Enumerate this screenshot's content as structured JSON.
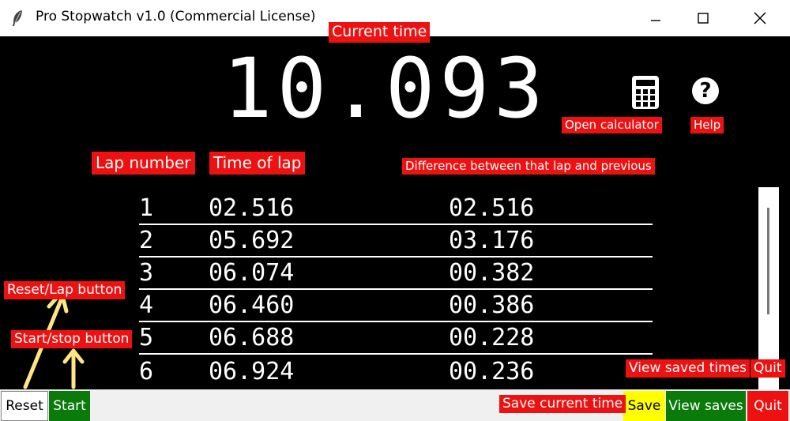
{
  "window": {
    "title": "Pro Stopwatch v1.0 (Commercial License)",
    "controls": [
      "minimize",
      "maximize",
      "close"
    ]
  },
  "stopwatch": {
    "current_time": "10.093"
  },
  "laps": [
    {
      "number": "1",
      "time": "02.516",
      "diff": "02.516"
    },
    {
      "number": "2",
      "time": "05.692",
      "diff": "03.176"
    },
    {
      "number": "3",
      "time": "06.074",
      "diff": "00.382"
    },
    {
      "number": "4",
      "time": "06.460",
      "diff": "00.386"
    },
    {
      "number": "5",
      "time": "06.688",
      "diff": "00.228"
    },
    {
      "number": "6",
      "time": "06.924",
      "diff": "00.236"
    }
  ],
  "buttons": {
    "reset": "Reset",
    "start": "Start",
    "save": "Save",
    "view_saves": "View saves",
    "quit": "Quit"
  },
  "annotations": {
    "current_time": "Current time",
    "open_calculator": "Open calculator",
    "help": "Help",
    "lap_number": "Lap number",
    "time_of_lap": "Time of lap",
    "difference": "Difference between that lap and previous",
    "reset_lap": "Reset/Lap button",
    "start_stop": "Start/stop button",
    "view_saved_times": "View saved times",
    "quit": "Quit",
    "save_current_time": "Save current time"
  },
  "colors": {
    "annotation_red": "#ee1111",
    "start_green": "#0a7a0a",
    "save_yellow": "#ffff00",
    "view_saves_green": "#0a7a0a",
    "quit_red": "#ee1111",
    "arrow_yellow": "#ffe680"
  },
  "icons": [
    "feather-icon",
    "calculator-icon",
    "help-icon",
    "minimize-icon",
    "maximize-icon",
    "close-icon"
  ]
}
